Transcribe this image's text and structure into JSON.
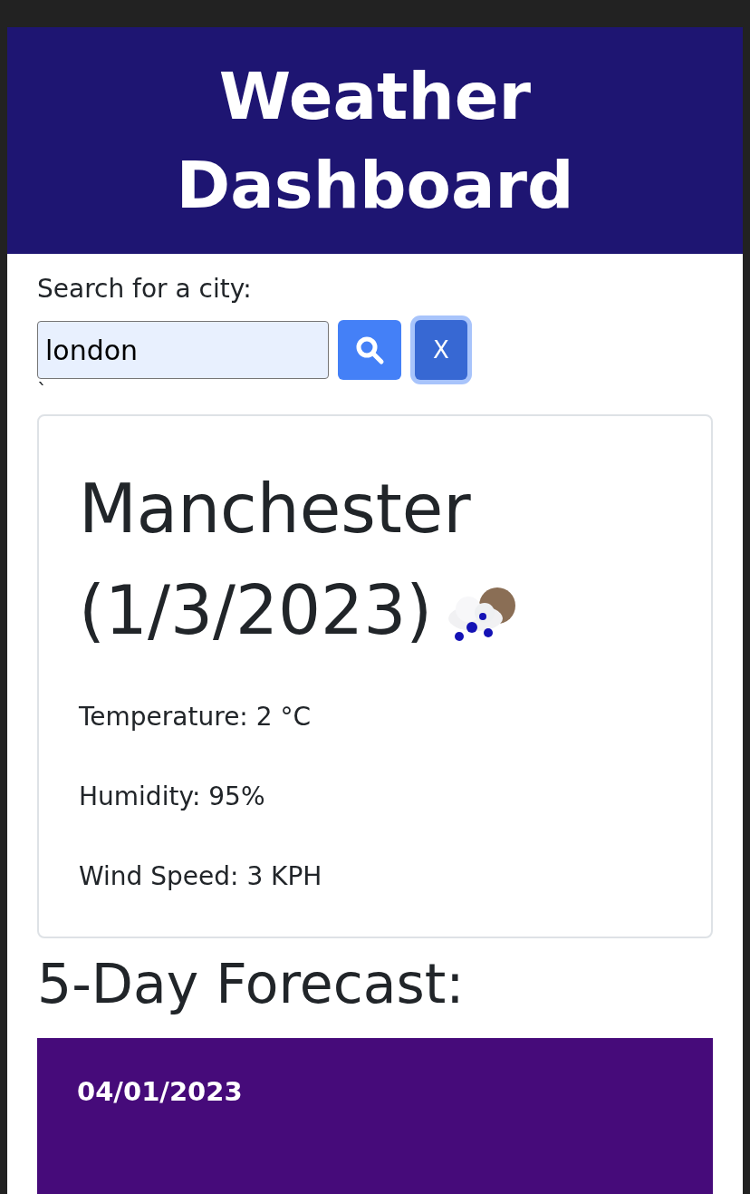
{
  "header": {
    "title": "Weather Dashboard"
  },
  "search": {
    "label": "Search for a city:",
    "value": "london",
    "clear_label": "X",
    "clear_focused": true,
    "stray_text": "`"
  },
  "current": {
    "heading": "Manchester (1/3/2023)",
    "stats": [
      "Temperature: 2 °C",
      "Humidity: 95%",
      "Wind Speed: 3 KPH"
    ]
  },
  "forecast": {
    "heading": "5-Day Forecast:",
    "days": [
      {
        "date": "04/01/2023"
      }
    ]
  }
}
